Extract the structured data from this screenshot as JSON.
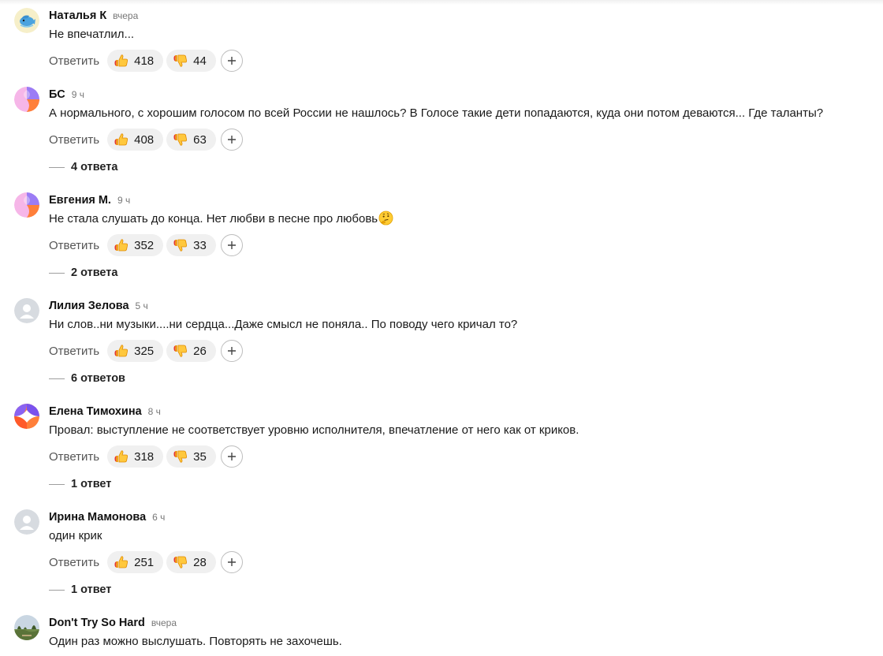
{
  "actions": {
    "reply_label": "Ответить"
  },
  "comments": [
    {
      "author": "Наталья К",
      "time": "вчера",
      "text": "Не впечатлил...",
      "likes": "418",
      "dislikes": "44",
      "replies": ""
    },
    {
      "author": "БС",
      "time": "9 ч",
      "text": "А нормального, с хорошим голосом по всей России не нашлось? В Голосе такие дети попадаются, куда они потом деваются... Где таланты?",
      "likes": "408",
      "dislikes": "63",
      "replies": "4 ответа"
    },
    {
      "author": "Евгения М.",
      "time": "9 ч",
      "text": "Не стала слушать до конца. Нет любви в песне про любовь",
      "likes": "352",
      "dislikes": "33",
      "replies": "2 ответа"
    },
    {
      "author": "Лилия Зелова",
      "time": "5 ч",
      "text": "Ни слов..ни музыки....ни сердца...Даже смысл не поняла.. По поводу чего кричал то?",
      "likes": "325",
      "dislikes": "26",
      "replies": "6 ответов"
    },
    {
      "author": "Елена Тимохина",
      "time": "8 ч",
      "text": "Провал: выступление не соответствует уровню исполнителя, впечатление от него как от криков.",
      "likes": "318",
      "dislikes": "35",
      "replies": "1 ответ"
    },
    {
      "author": "Ирина Мамонова",
      "time": "6 ч",
      "text": "один крик",
      "likes": "251",
      "dislikes": "28",
      "replies": "1 ответ"
    },
    {
      "author": "Don't Try So Hard",
      "time": "вчера",
      "text": "Один раз можно выслушать. Повторять не захочешь.",
      "likes": "",
      "dislikes": "",
      "replies": ""
    }
  ],
  "icons": {
    "like": "thumbs-up-icon",
    "dislike": "thumbs-down-icon",
    "add": "plus-icon",
    "thinking": "thinking-face-icon"
  },
  "colors": {
    "pill_bg": "#f0f0f0",
    "meta_gray": "#777777"
  }
}
